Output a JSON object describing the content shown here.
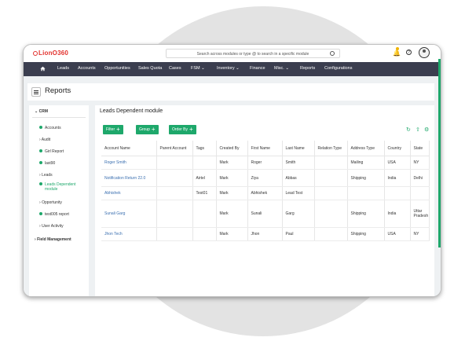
{
  "app": {
    "logo": "LionO360"
  },
  "search": {
    "placeholder": "Search across modules or type @ to search in a specific module"
  },
  "nav": [
    "Leads",
    "Accounts",
    "Opportunities",
    "Sales Quota",
    "Cases",
    "FSM",
    "Inventory",
    "Finance",
    "Misc.",
    "Reports",
    "Configurations"
  ],
  "page": {
    "title": "Reports"
  },
  "sidebar": {
    "section": "CRM",
    "items": [
      {
        "label": "Accounts",
        "type": "dot"
      },
      {
        "label": "Audit",
        "type": "chev"
      },
      {
        "label": "Girl Report",
        "type": "dot"
      },
      {
        "label": "last90",
        "type": "dot"
      },
      {
        "label": "Leads",
        "type": "chev"
      },
      {
        "label": "Leads Dependent",
        "label2": "module",
        "type": "dot",
        "active": true
      },
      {
        "label": "Opportunity",
        "type": "chev"
      },
      {
        "label": "test005 report",
        "type": "dot"
      },
      {
        "label": "User Activity",
        "type": "chev"
      }
    ],
    "next_section": "Field Management"
  },
  "main": {
    "title": "Leads Dependent module",
    "buttons": {
      "filter": "Filter",
      "group": "Group",
      "order": "Order By"
    }
  },
  "table": {
    "headers": [
      "Account Name",
      "Parent Account",
      "Tags",
      "Created By",
      "First Name",
      "Last Name",
      "Relation Type",
      "Address Type",
      "Country",
      "State"
    ],
    "rows": [
      [
        "Roger Smith",
        "",
        "",
        "Mark",
        "Roger",
        "Smith",
        "",
        "Mailing",
        "USA",
        "NY"
      ],
      [
        "Notification Return 22.0",
        "",
        "Airtel",
        "Mark",
        "Ziya",
        "Abbas",
        "",
        "Shipping",
        "India",
        "Delhi"
      ],
      [
        "Abhishek",
        "",
        "Test01",
        "Mark",
        "Abhishek",
        "Lead Test",
        "",
        "",
        "",
        ""
      ],
      [
        "Sunali Garg",
        "",
        "",
        "Mark",
        "Sunali",
        "Garg",
        "",
        "Shipping",
        "India",
        "Uttar Pradesh"
      ],
      [
        "Jhon Tech",
        "",
        "",
        "Mark",
        "Jhon",
        "Paul",
        "",
        "Shipping",
        "USA",
        "NY"
      ]
    ]
  },
  "colors": {
    "accent": "#1ea86b",
    "nav": "#3b3e4f",
    "brand": "#e2312d"
  }
}
